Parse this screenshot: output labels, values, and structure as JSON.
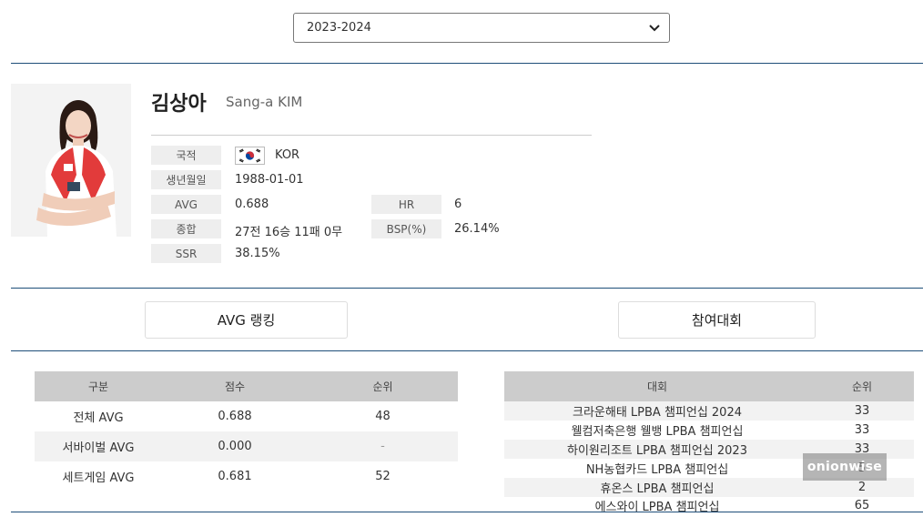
{
  "season_select": {
    "value": "2023-2024"
  },
  "player": {
    "name_ko": "김상아",
    "name_en": "Sang-a KIM",
    "fields": {
      "nationality_label": "국적",
      "nationality_value": "KOR",
      "birth_label": "생년월일",
      "birth_value": "1988-01-01",
      "avg_label": "AVG",
      "avg_value": "0.688",
      "hr_label": "HR",
      "hr_value": "6",
      "total_label": "종합",
      "total_value": "27전 16승 11패 0무",
      "bsp_label": "BSP(%)",
      "bsp_value": "26.14%",
      "ssr_label": "SSR",
      "ssr_value": "38.15%"
    }
  },
  "tabs": {
    "avg_ranking": "AVG 랭킹",
    "tournaments": "참여대회"
  },
  "avg_table": {
    "headers": [
      "구분",
      "점수",
      "순위"
    ],
    "rows": [
      [
        "전체 AVG",
        "0.688",
        "48"
      ],
      [
        "서바이벌 AVG",
        "0.000",
        "-"
      ],
      [
        "세트게임 AVG",
        "0.681",
        "52"
      ]
    ]
  },
  "tournament_table": {
    "headers": [
      "대회",
      "순위"
    ],
    "rows": [
      [
        "크라운해태 LPBA 챔피언십 2024",
        "33"
      ],
      [
        "웰컴저축은행 웰뱅 LPBA 챔피언십",
        "33"
      ],
      [
        "하이원리조트 LPBA 챔피언십 2023",
        "33"
      ],
      [
        "NH농협카드 LPBA 챔피언십",
        "5"
      ],
      [
        "휴온스 LPBA 챔피언십",
        "2"
      ],
      [
        "에스와이 LPBA 챔피언십",
        "65"
      ]
    ]
  },
  "watermark": "onionwise",
  "colors": {
    "divider": "#1e4e79",
    "table_header": "#cccccc",
    "label_bg": "#eeeeee",
    "flag_red": "#cd2e3a",
    "flag_blue": "#0047a0"
  }
}
